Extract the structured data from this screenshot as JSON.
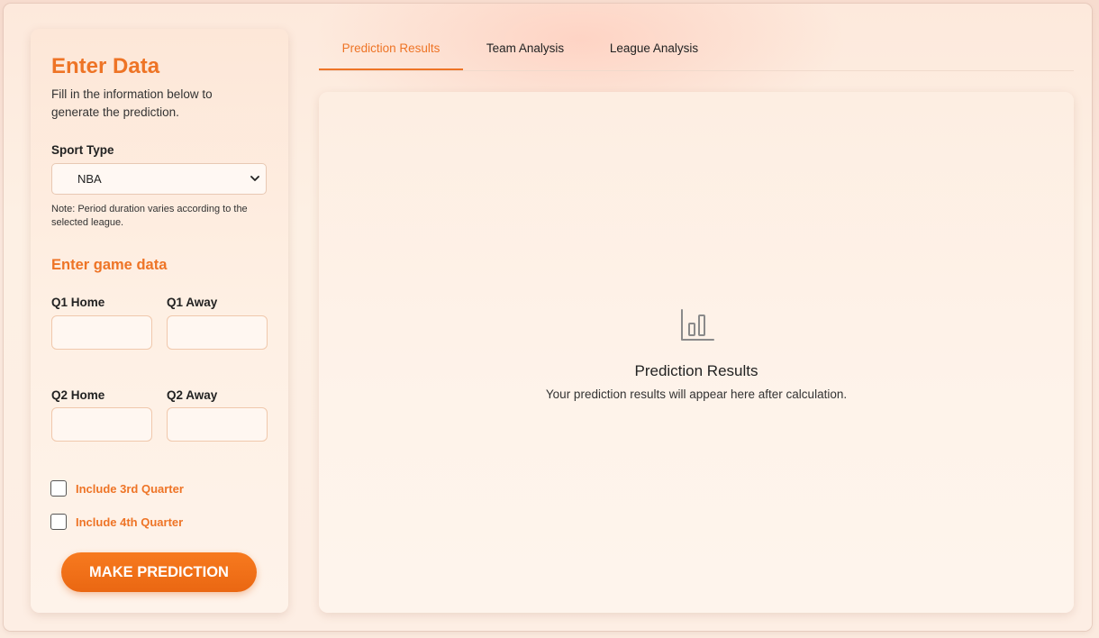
{
  "sidebar": {
    "title": "Enter Data",
    "description": "Fill in the information below to generate the prediction.",
    "sport_type_label": "Sport Type",
    "sport_type_value": "NBA",
    "note": "Note: Period duration varies according to the selected league.",
    "game_data_heading": "Enter game data",
    "fields": {
      "q1_home_label": "Q1 Home",
      "q1_away_label": "Q1 Away",
      "q2_home_label": "Q2 Home",
      "q2_away_label": "Q2 Away"
    },
    "checkboxes": {
      "q3_label": "Include 3rd Quarter",
      "q4_label": "Include 4th Quarter"
    },
    "predict_button": "MAKE PREDICTION"
  },
  "tabs": [
    {
      "label": "Prediction Results",
      "active": true
    },
    {
      "label": "Team Analysis",
      "active": false
    },
    {
      "label": "League Analysis",
      "active": false
    }
  ],
  "results": {
    "icon": "bar-chart-icon",
    "title": "Prediction Results",
    "subtitle": "Your prediction results will appear here after calculation."
  },
  "colors": {
    "accent": "#ee7426",
    "button": "#f47320"
  }
}
